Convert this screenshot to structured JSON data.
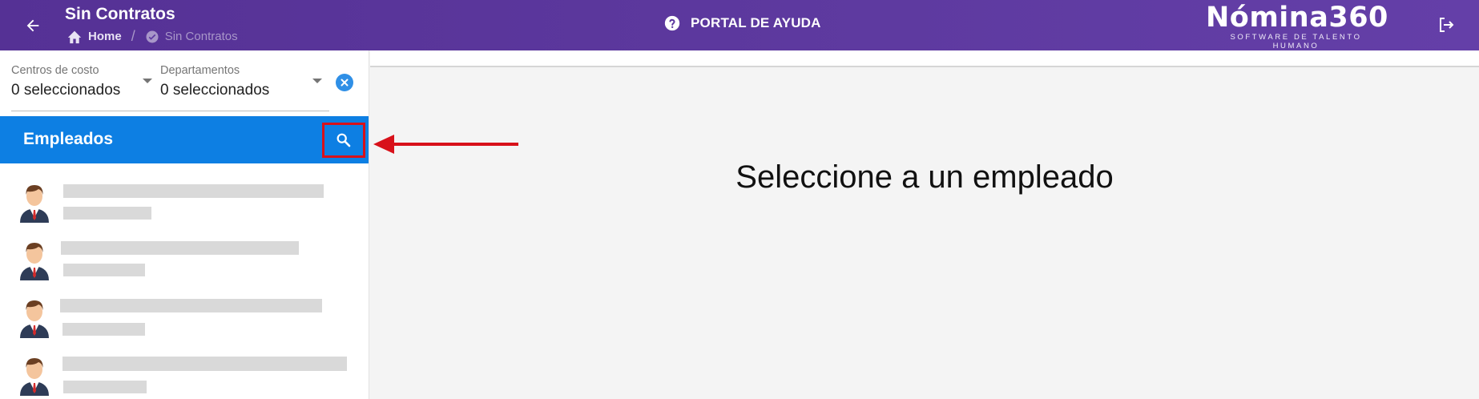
{
  "header": {
    "title": "Sin Contratos",
    "breadcrumb": {
      "home": "Home",
      "current": "Sin Contratos"
    },
    "help_label": "PORTAL DE AYUDA",
    "brand_name": "Nómina360",
    "brand_tagline": "SOFTWARE DE TALENTO HUMANO"
  },
  "filters": [
    {
      "label": "Centros de costo",
      "value": "0 seleccionados"
    },
    {
      "label": "Departamentos",
      "value": "0 seleccionados"
    }
  ],
  "employees": {
    "title": "Empleados",
    "items": [
      "placeholder",
      "placeholder",
      "placeholder",
      "placeholder"
    ]
  },
  "main": {
    "empty_message": "Seleccione a un empleado"
  },
  "colors": {
    "header": "#5a35a0",
    "employees_bar": "#0d7fe3",
    "highlight": "#d8111a",
    "skeleton": "#d9d9d9"
  }
}
